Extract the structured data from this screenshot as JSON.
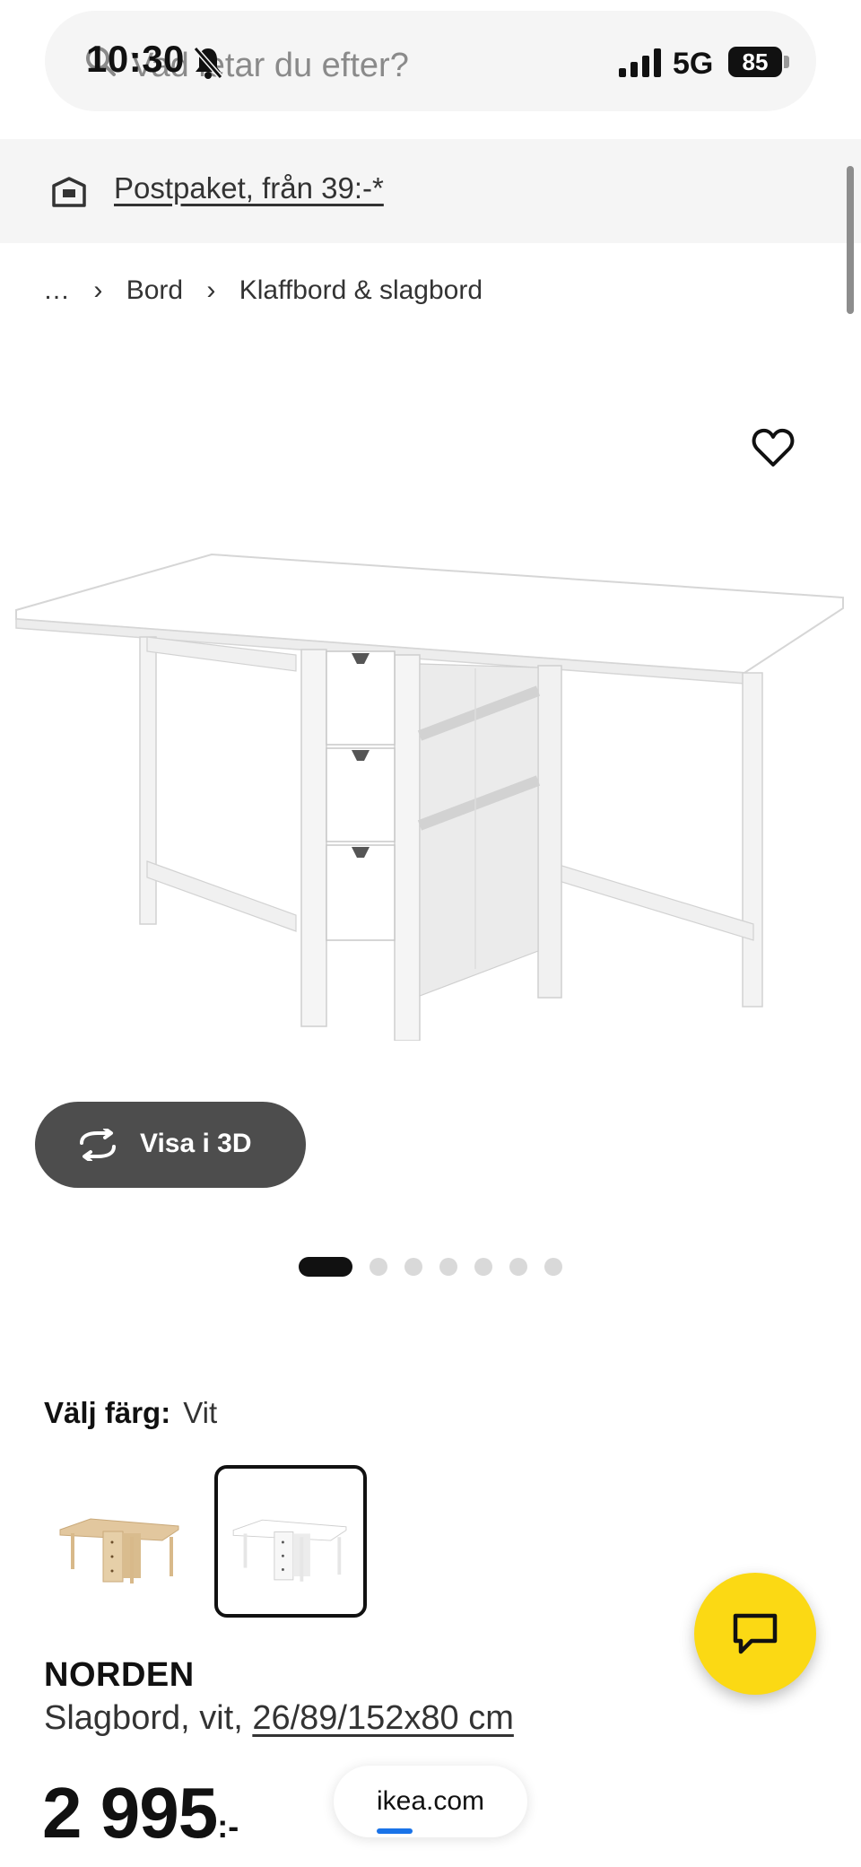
{
  "status_bar": {
    "time": "10:30",
    "network": "5G",
    "battery": "85"
  },
  "search": {
    "placeholder": "Vad letar du efter?"
  },
  "shipping_banner": {
    "text": "Postpaket, från 39:-*"
  },
  "breadcrumb": {
    "items": [
      "…",
      "Bord",
      "Klaffbord & slagbord"
    ]
  },
  "gallery": {
    "view_3d_label": "Visa i 3D",
    "dot_count": 7,
    "active_index": 0
  },
  "color_picker": {
    "label": "Välj färg:",
    "selected": "Vit",
    "options": [
      "natural-wood",
      "white"
    ]
  },
  "product": {
    "name": "NORDEN",
    "description": "Slagbord, vit, ",
    "dimensions": "26/89/152x80 cm",
    "price": "2 995",
    "price_suffix": ":-"
  },
  "browser": {
    "url": "ikea.com"
  }
}
